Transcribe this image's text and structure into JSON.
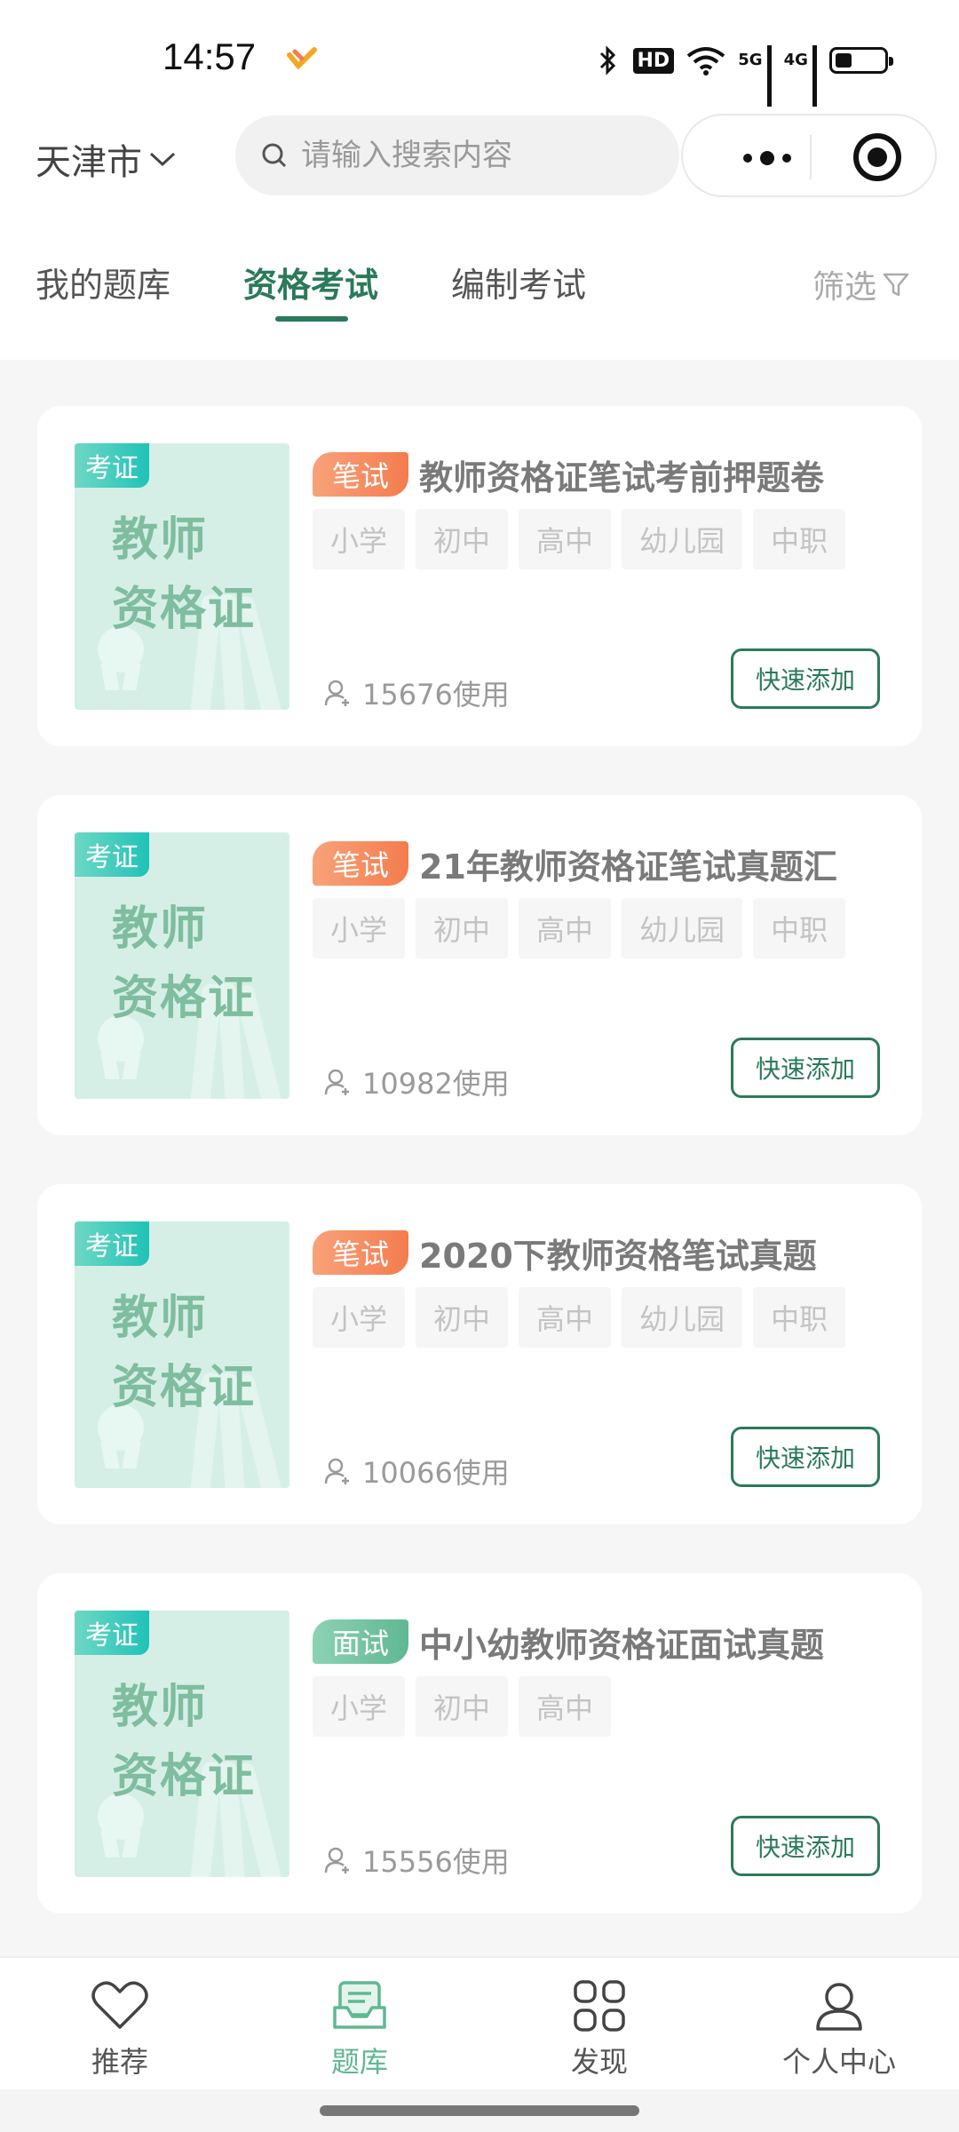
{
  "status": {
    "time": "14:57",
    "hd": "HD",
    "sig1": "5G",
    "sig2": "4G"
  },
  "header": {
    "city": "天津市",
    "search_placeholder": "请输入搜索内容"
  },
  "tabs": [
    {
      "label": "我的题库",
      "active": false
    },
    {
      "label": "资格考试",
      "active": true
    },
    {
      "label": "编制考试",
      "active": false
    }
  ],
  "filter_label": "筛选",
  "cards": [
    {
      "cover_badge": "考证",
      "cover_line1": "教师",
      "cover_line2": "资格证",
      "type": "笔试",
      "title": "教师资格证笔试考前押题卷",
      "levels": [
        "小学",
        "初中",
        "高中",
        "幼儿园",
        "中职"
      ],
      "usage": "15676使用",
      "button": "快速添加"
    },
    {
      "cover_badge": "考证",
      "cover_line1": "教师",
      "cover_line2": "资格证",
      "type": "笔试",
      "title": "21年教师资格证笔试真题汇",
      "levels": [
        "小学",
        "初中",
        "高中",
        "幼儿园",
        "中职"
      ],
      "usage": "10982使用",
      "button": "快速添加"
    },
    {
      "cover_badge": "考证",
      "cover_line1": "教师",
      "cover_line2": "资格证",
      "type": "笔试",
      "title": "2020下教师资格笔试真题",
      "levels": [
        "小学",
        "初中",
        "高中",
        "幼儿园",
        "中职"
      ],
      "usage": "10066使用",
      "button": "快速添加"
    },
    {
      "cover_badge": "考证",
      "cover_line1": "教师",
      "cover_line2": "资格证",
      "type": "面试",
      "title": "中小幼教师资格证面试真题",
      "levels": [
        "小学",
        "初中",
        "高中"
      ],
      "usage": "15556使用",
      "button": "快速添加"
    }
  ],
  "bottom_nav": [
    {
      "label": "推荐",
      "icon": "heart-icon",
      "active": false
    },
    {
      "label": "题库",
      "icon": "question-bank-icon",
      "active": true
    },
    {
      "label": "发现",
      "icon": "grid-icon",
      "active": false
    },
    {
      "label": "个人中心",
      "icon": "person-icon",
      "active": false
    }
  ],
  "colors": {
    "accent": "#2b7a5a",
    "accent_light": "#5fb892",
    "tag_written": "#f47c4e",
    "tag_oral": "#5fb892"
  }
}
